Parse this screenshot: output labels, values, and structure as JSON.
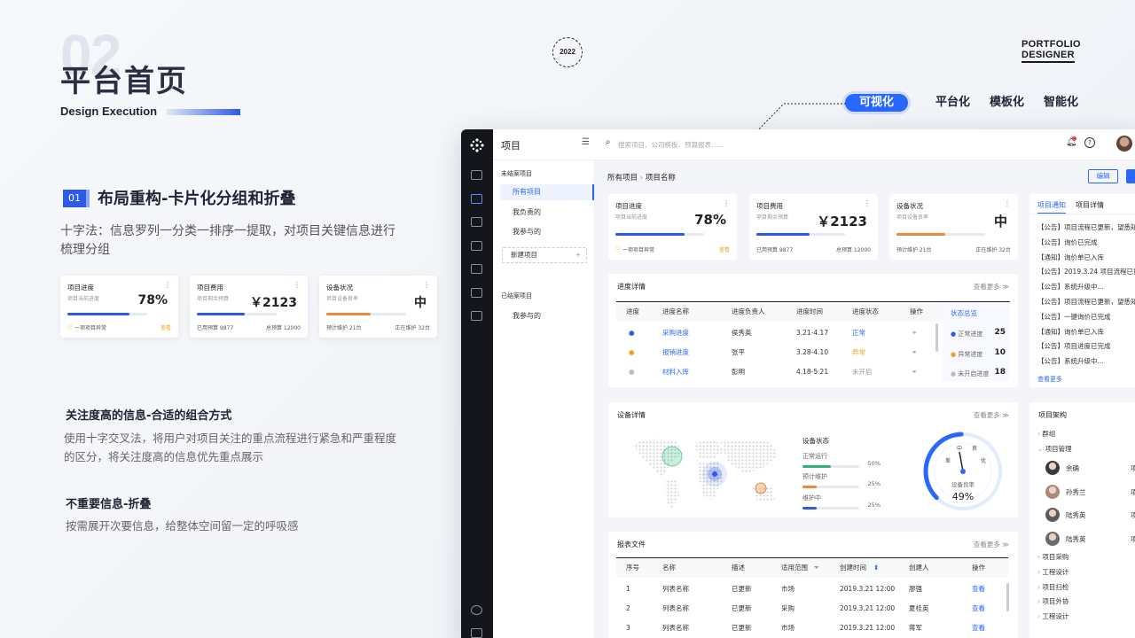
{
  "header": {
    "section_number": "02",
    "title": "平台首页",
    "subtitle": "Design Execution",
    "year": "2022",
    "logo_line1": "PORTFOLIO",
    "logo_line2": "DESIGNER"
  },
  "tags": [
    {
      "label": "可视化",
      "active": true
    },
    {
      "label": "平台化"
    },
    {
      "label": "模板化"
    },
    {
      "label": "智能化"
    }
  ],
  "section": {
    "num": "01",
    "title": "布局重构-卡片化分组和折叠",
    "desc": "十字法：信息罗列一分类一排序一提取，对项目关键信息进行梳理分组"
  },
  "mini_cards": [
    {
      "title": "项目进度",
      "sub": "项目当前进度",
      "value": "78%",
      "progress": 0.78,
      "color": "#2d5ae6",
      "foot_left": "一项项目异常",
      "foot_right": "查看"
    },
    {
      "title": "项目费用",
      "sub": "项目剩余预算",
      "value": "￥2123",
      "progress": 0.6,
      "color": "#2d5ae6",
      "foot_left": "已用预算  9877",
      "foot_right": "总预算  12000"
    },
    {
      "title": "设备状况",
      "sub": "项目设备良率",
      "value": "中",
      "progress": 0.55,
      "color": "#e88a3a",
      "foot_left": "预计维护  21台",
      "foot_right": "正在维护  32台"
    }
  ],
  "notes": [
    {
      "title": "关注度高的信息-合适的组合方式",
      "body": "使用十字交叉法，将用户对项目关注的重点流程进行紧急和严重程度的区分，将关注度高的信息优先重点展示"
    },
    {
      "title": "不重要信息-折叠",
      "body": "按需展开次要信息，给整体空间留一定的呼吸感"
    }
  ],
  "app": {
    "title": "项目",
    "search_placeholder": "搜索项目、公司模板、预算报表……",
    "nav_unfinished": "未结案项目",
    "nav_items": [
      "所有项目",
      "我负责的",
      "我参与的"
    ],
    "new_project": "新建项目",
    "nav_finished": "已结案项目",
    "nav_finished_items": [
      "我参与的"
    ],
    "breadcrumb": [
      "所有项目",
      "项目名称"
    ],
    "edit_button": "编辑",
    "cards": [
      {
        "title": "项目进度",
        "sub": "项目当前进度",
        "value": "78%",
        "progress": 0.78,
        "color": "#2d5ae6",
        "foot_left": "一项项目异常",
        "foot_right": "查看"
      },
      {
        "title": "项目费用",
        "sub": "项目剩余预算",
        "value": "￥2123",
        "progress": 0.6,
        "color": "#2d5ae6",
        "foot_left": "已用预算  9877",
        "foot_right": "总预算  12000"
      },
      {
        "title": "设备状况",
        "sub": "项目设备良率",
        "value": "中",
        "progress": 0.55,
        "color": "#e88a3a",
        "foot_left": "预计维护  21台",
        "foot_right": "正在维护  32台"
      }
    ],
    "progress_panel": {
      "title": "进度详情",
      "more": "查看更多",
      "headers": [
        "进度",
        "进度名称",
        "进度负责人",
        "进度时间",
        "进度状态",
        "操作"
      ],
      "rows": [
        {
          "name": "采购进度",
          "owner": "侯秀英",
          "time": "3.21-4.17",
          "status": "正常",
          "dot": "#2d5ae6"
        },
        {
          "name": "报销进度",
          "owner": "张平",
          "time": "3.28-4.10",
          "status": "异常",
          "dot": "#f0a020"
        },
        {
          "name": "材料入库",
          "owner": "彭明",
          "time": "4.18-5.21",
          "status": "未开启",
          "dot": "#bbb"
        }
      ],
      "summary_title": "状态总览",
      "summary": [
        {
          "label": "正常进度",
          "value": "25",
          "dot": "#2d5ae6"
        },
        {
          "label": "异常进度",
          "value": "10",
          "dot": "#f0a020"
        },
        {
          "label": "未开启进度",
          "value": "18",
          "dot": "#bbb"
        }
      ]
    },
    "device_panel": {
      "title": "设备详情",
      "more": "查看更多",
      "status_title": "设备状态",
      "statuses": [
        {
          "label": "正常运行",
          "value": "50%",
          "color": "#2bb673",
          "fraction": 0.5
        },
        {
          "label": "预计维护",
          "value": "25%",
          "color": "#e88a3a",
          "fraction": 0.25
        },
        {
          "label": "维护中",
          "value": "25%",
          "color": "#2d5ae6",
          "fraction": 0.25
        }
      ],
      "gauge_labels": [
        "差",
        "中",
        "良",
        "优"
      ],
      "gauge_caption": "设备良率",
      "gauge_value": "49%",
      "gauge_fraction": 0.49
    },
    "report_panel": {
      "title": "报表文件",
      "more": "查看更多",
      "headers": [
        "序号",
        "名称",
        "描述",
        "适用范围",
        "创建时间",
        "创建人",
        "操作"
      ],
      "rows": [
        [
          "1",
          "列表名称",
          "已更新",
          "市场",
          "2019.3.21 12:00",
          "廖强",
          "查看"
        ],
        [
          "2",
          "列表名称",
          "已更新",
          "采购",
          "2019.3.21 12:00",
          "夏桂英",
          "查看"
        ],
        [
          "3",
          "列表名称",
          "已更新",
          "市场",
          "2019.3.21 12:00",
          "蒋军",
          "查看"
        ]
      ]
    },
    "notice_panel": {
      "tabs": [
        "项目通知",
        "项目详情"
      ],
      "items": [
        "【公告】项目流程已更新，望悉知",
        "【公告】询价已完成",
        "【通知】询价单已入库",
        "【公告】2019.3.24 项目流程已更新",
        "【公告】系统升级中...",
        "【公告】项目流程已更新，望悉知",
        "【公告】一键询价已完成",
        "【通知】询价单已入库",
        "【公告】项目进度已完成",
        "【公告】系统升级中..."
      ],
      "more": "查看更多"
    },
    "org_panel": {
      "title": "项目架构",
      "items_top": [
        "群组",
        "项目管理"
      ],
      "members": [
        {
          "name": "余确",
          "role": "项目"
        },
        {
          "name": "孙秀兰",
          "role": "项目"
        },
        {
          "name": "陆秀英",
          "role": "项目"
        },
        {
          "name": "陆秀英",
          "role": "项目"
        }
      ],
      "items_bottom": [
        "项目采购",
        "工程设计",
        "项目扫检",
        "项目外协",
        "工程设计"
      ]
    }
  }
}
